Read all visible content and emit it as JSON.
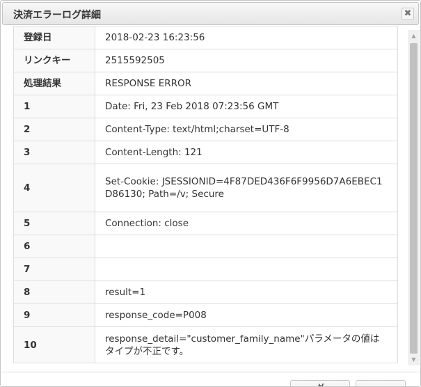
{
  "dialog": {
    "title": "決済エラーログ詳細",
    "close_glyph": "✖"
  },
  "rows": [
    {
      "key": "登録日",
      "value": "2018-02-23 16:23:56"
    },
    {
      "key": "リンクキー",
      "value": "2515592505"
    },
    {
      "key": "処理結果",
      "value": "RESPONSE ERROR"
    },
    {
      "key": "1",
      "value": "Date: Fri, 23 Feb 2018 07:23:56 GMT"
    },
    {
      "key": "2",
      "value": "Content-Type: text/html;charset=UTF-8"
    },
    {
      "key": "3",
      "value": "Content-Length: 121"
    },
    {
      "key": "4",
      "value": "Set-Cookie: JSESSIONID=4F87DED436F6F9956D7A6EBEC1D86130; Path=/v; Secure"
    },
    {
      "key": "5",
      "value": "Connection: close"
    },
    {
      "key": "6",
      "value": ""
    },
    {
      "key": "7",
      "value": ""
    },
    {
      "key": "8",
      "value": "result=1"
    },
    {
      "key": "9",
      "value": "response_code=P008"
    },
    {
      "key": "10",
      "value": "response_detail=\"customer_family_name\"パラメータの値はタイプが不正です。"
    }
  ],
  "footer": {
    "button1_label": "ダ",
    "button2_label": ""
  }
}
